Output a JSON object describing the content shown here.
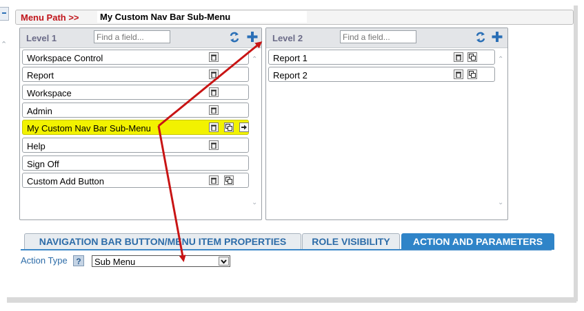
{
  "menu_path": {
    "label": "Menu Path >>",
    "value": "My Custom Nav Bar Sub-Menu"
  },
  "level1": {
    "title": "Level 1",
    "search_placeholder": "Find a field...",
    "items": [
      {
        "label": "Workspace Control",
        "icons": [
          "trash-icon"
        ]
      },
      {
        "label": "Report",
        "icons": [
          "trash-icon"
        ]
      },
      {
        "label": "Workspace",
        "icons": [
          "trash-icon"
        ]
      },
      {
        "label": "Admin",
        "icons": [
          "trash-icon"
        ]
      },
      {
        "label": "My Custom Nav Bar Sub-Menu",
        "icons": [
          "trash-icon",
          "copy-icon",
          "arrow-right-icon"
        ],
        "selected": true
      },
      {
        "label": "Help",
        "icons": [
          "trash-icon"
        ]
      },
      {
        "label": "Sign Off",
        "icons": []
      },
      {
        "label": "Custom Add Button",
        "icons": [
          "trash-icon",
          "copy-icon"
        ]
      }
    ]
  },
  "level2": {
    "title": "Level 2",
    "search_placeholder": "Find a field...",
    "items": [
      {
        "label": "Report 1",
        "icons": [
          "trash-icon",
          "copy-icon"
        ]
      },
      {
        "label": "Report 2",
        "icons": [
          "trash-icon",
          "copy-icon"
        ]
      }
    ]
  },
  "tabs": [
    {
      "label": "NAVIGATION BAR BUTTON/MENU ITEM PROPERTIES",
      "active": false
    },
    {
      "label": "ROLE VISIBILITY",
      "active": false
    },
    {
      "label": "ACTION AND PARAMETERS",
      "active": true
    }
  ],
  "action_type": {
    "label": "Action Type",
    "help": "?",
    "value": "Sub Menu"
  },
  "colors": {
    "path_label": "#c0141a",
    "panel_title": "#6b6b88",
    "selected_row": "#f2f200",
    "tab_text": "#2d6ca8",
    "tab_active": "#2f84c8",
    "annotation_arrow": "#c81414"
  }
}
